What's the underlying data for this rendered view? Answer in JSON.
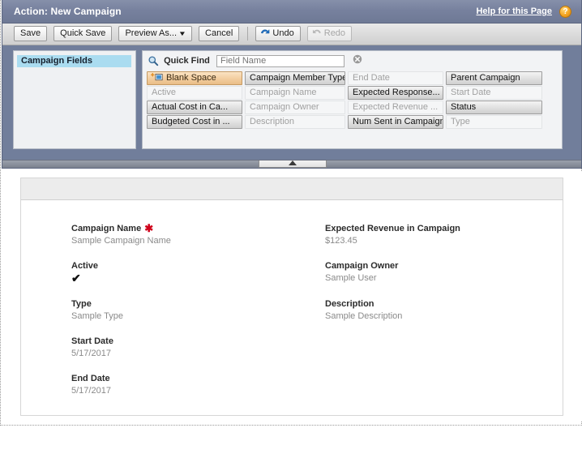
{
  "window": {
    "title": "Action: New Campaign",
    "help_link": "Help for this Page",
    "help_icon": "question-mark-icon"
  },
  "toolbar": {
    "save_label": "Save",
    "quick_save_label": "Quick Save",
    "preview_as_label": "Preview As...",
    "preview_as_caret": "▼",
    "cancel_label": "Cancel",
    "undo_label": "Undo",
    "redo_label": "Redo",
    "undo_enabled": true,
    "redo_enabled": false
  },
  "palette": {
    "categories": [
      {
        "label": "Campaign Fields",
        "selected": true
      }
    ],
    "quick_find": {
      "icon": "magnifier-icon",
      "label": "Quick Find",
      "value": "",
      "placeholder": "Field Name",
      "clear_icon": "clear-icon"
    },
    "rows": [
      [
        {
          "label": "Blank Space",
          "state": "blank"
        },
        {
          "label": "Campaign Member Type",
          "state": "available"
        },
        {
          "label": "End Date",
          "state": "used"
        },
        {
          "label": "Parent Campaign",
          "state": "available"
        }
      ],
      [
        {
          "label": "Active",
          "state": "used"
        },
        {
          "label": "Campaign Name",
          "state": "used"
        },
        {
          "label": "Expected Response...",
          "state": "available"
        },
        {
          "label": "Start Date",
          "state": "used"
        }
      ],
      [
        {
          "label": "Actual Cost in Ca...",
          "state": "available"
        },
        {
          "label": "Campaign Owner",
          "state": "used"
        },
        {
          "label": "Expected Revenue ...",
          "state": "used"
        },
        {
          "label": "Status",
          "state": "available"
        }
      ],
      [
        {
          "label": "Budgeted Cost in ...",
          "state": "available"
        },
        {
          "label": "Description",
          "state": "used"
        },
        {
          "label": "Num Sent in Campaign",
          "state": "available"
        },
        {
          "label": "Type",
          "state": "used"
        }
      ]
    ]
  },
  "splitter": {
    "collapse_icon": "triangle-up-icon"
  },
  "preview": {
    "left_column": [
      {
        "label": "Campaign Name",
        "required": true,
        "value": "Sample Campaign Name",
        "type": "text"
      },
      {
        "label": "Active",
        "required": false,
        "value": "✔",
        "type": "checkbox"
      },
      {
        "label": "Type",
        "required": false,
        "value": "Sample Type",
        "type": "text"
      },
      {
        "label": "Start Date",
        "required": false,
        "value": "5/17/2017",
        "type": "text"
      },
      {
        "label": "End Date",
        "required": false,
        "value": "5/17/2017",
        "type": "text"
      }
    ],
    "right_column": [
      {
        "label": "Expected Revenue in Campaign",
        "required": false,
        "value": "$123.45",
        "type": "text"
      },
      {
        "label": "Campaign Owner",
        "required": false,
        "value": "Sample User",
        "type": "text"
      },
      {
        "label": "Description",
        "required": false,
        "value": "Sample Description",
        "type": "text"
      }
    ]
  },
  "colors": {
    "header_blue": "#717e9b",
    "selected_category": "#aadcf0",
    "blank_space_tan": "#f3cfa2",
    "required_red": "#d0021b",
    "help_orange": "#f5a623"
  }
}
